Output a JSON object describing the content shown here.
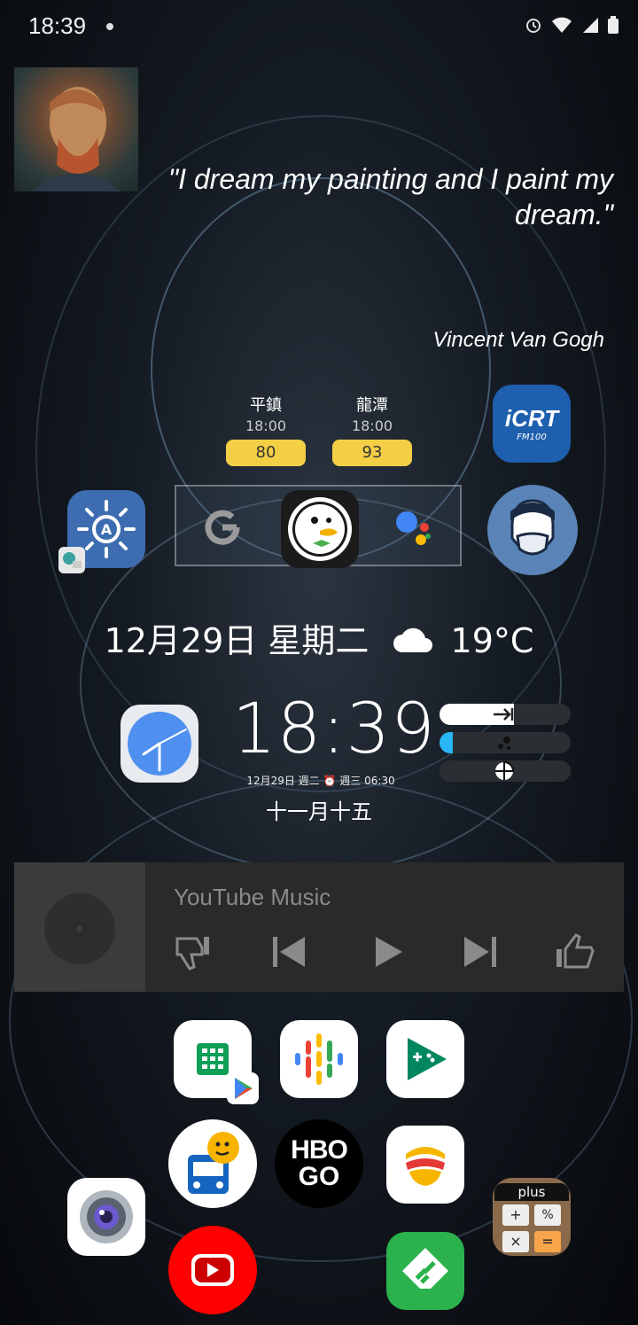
{
  "status_bar": {
    "time": "18:39"
  },
  "quote_widget": {
    "quote": "\"I dream my painting and I paint my dream.\"",
    "author": "Vincent Van Gogh"
  },
  "air_quality": [
    {
      "station": "平鎮",
      "time": "18:00",
      "value": "80"
    },
    {
      "station": "龍潭",
      "time": "18:00",
      "value": "93"
    }
  ],
  "apps": {
    "icrt": {
      "label": "iCRT",
      "sub": "FM100"
    },
    "calculator": {
      "badge": "plus",
      "keys": [
        "+",
        "%",
        "×",
        "="
      ]
    },
    "hbo": {
      "line1": "HBO",
      "line2": "GO"
    }
  },
  "date_weather": {
    "date": "12月29日 星期二",
    "temperature": "19°C"
  },
  "clock_widget": {
    "time": "18:39",
    "sub": "12月29日 週二 ⏰ 週三 06:30",
    "lunar": "十一月十五",
    "brightness_level": 0.57,
    "volume_level": 0.1
  },
  "music_widget": {
    "title": "YouTube Music"
  }
}
